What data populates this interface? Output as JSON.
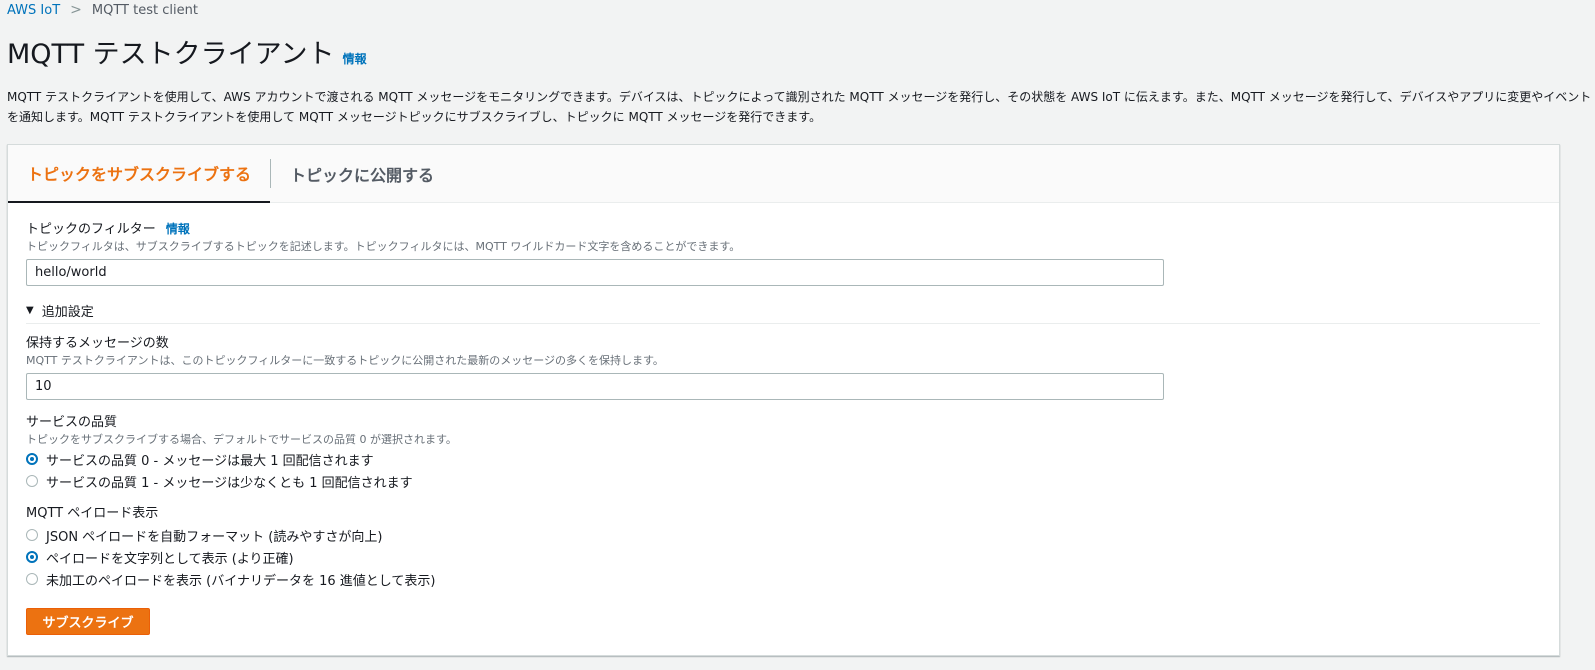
{
  "breadcrumb": {
    "items": [
      "AWS IoT",
      "MQTT test client"
    ],
    "separator": ">"
  },
  "header": {
    "title": "MQTT テストクライアント",
    "info_link": "情報"
  },
  "description": "MQTT テストクライアントを使用して、AWS アカウントで渡される MQTT メッセージをモニタリングできます。デバイスは、トピックによって識別された MQTT メッセージを発行し、その状態を AWS IoT に伝えます。また、MQTT メッセージを発行して、デバイスやアプリに変更やイベントを通知します。MQTT テストクライアントを使用して MQTT メッセージトピックにサブスクライブし、トピックに MQTT メッセージを発行できます。",
  "tabs": [
    {
      "label": "トピックをサブスクライブする",
      "active": true
    },
    {
      "label": "トピックに公開する",
      "active": false
    }
  ],
  "topic_filter": {
    "label": "トピックのフィルター",
    "info_link": "情報",
    "description": "トピックフィルタは、サブスクライブするトピックを記述します。トピックフィルタには、MQTT ワイルドカード文字を含めることができます。",
    "value": "hello/world"
  },
  "additional_settings": {
    "label": "追加設定",
    "expanded": true
  },
  "retained_messages": {
    "label": "保持するメッセージの数",
    "description": "MQTT テストクライアントは、このトピックフィルターに一致するトピックに公開された最新のメッセージの多くを保持します。",
    "value": "10"
  },
  "qos": {
    "label": "サービスの品質",
    "description": "トピックをサブスクライブする場合、デフォルトでサービスの品質 0 が選択されます。",
    "options": [
      {
        "label": "サービスの品質 0 - メッセージは最大 1 回配信されます",
        "checked": true
      },
      {
        "label": "サービスの品質 1 - メッセージは少なくとも 1 回配信されます",
        "checked": false
      }
    ]
  },
  "payload_display": {
    "label": "MQTT ペイロード表示",
    "options": [
      {
        "label": "JSON ペイロードを自動フォーマット (読みやすさが向上)",
        "checked": false
      },
      {
        "label": "ペイロードを文字列として表示 (より正確)",
        "checked": true
      },
      {
        "label": "未加工のペイロードを表示 (バイナリデータを 16 進値として表示)",
        "checked": false
      }
    ]
  },
  "subscribe_button": "サブスクライブ",
  "colors": {
    "accent": "#ec7211",
    "link": "#0073bb",
    "radio_checked": "#0073bb",
    "page_bg": "#f2f3f3"
  }
}
